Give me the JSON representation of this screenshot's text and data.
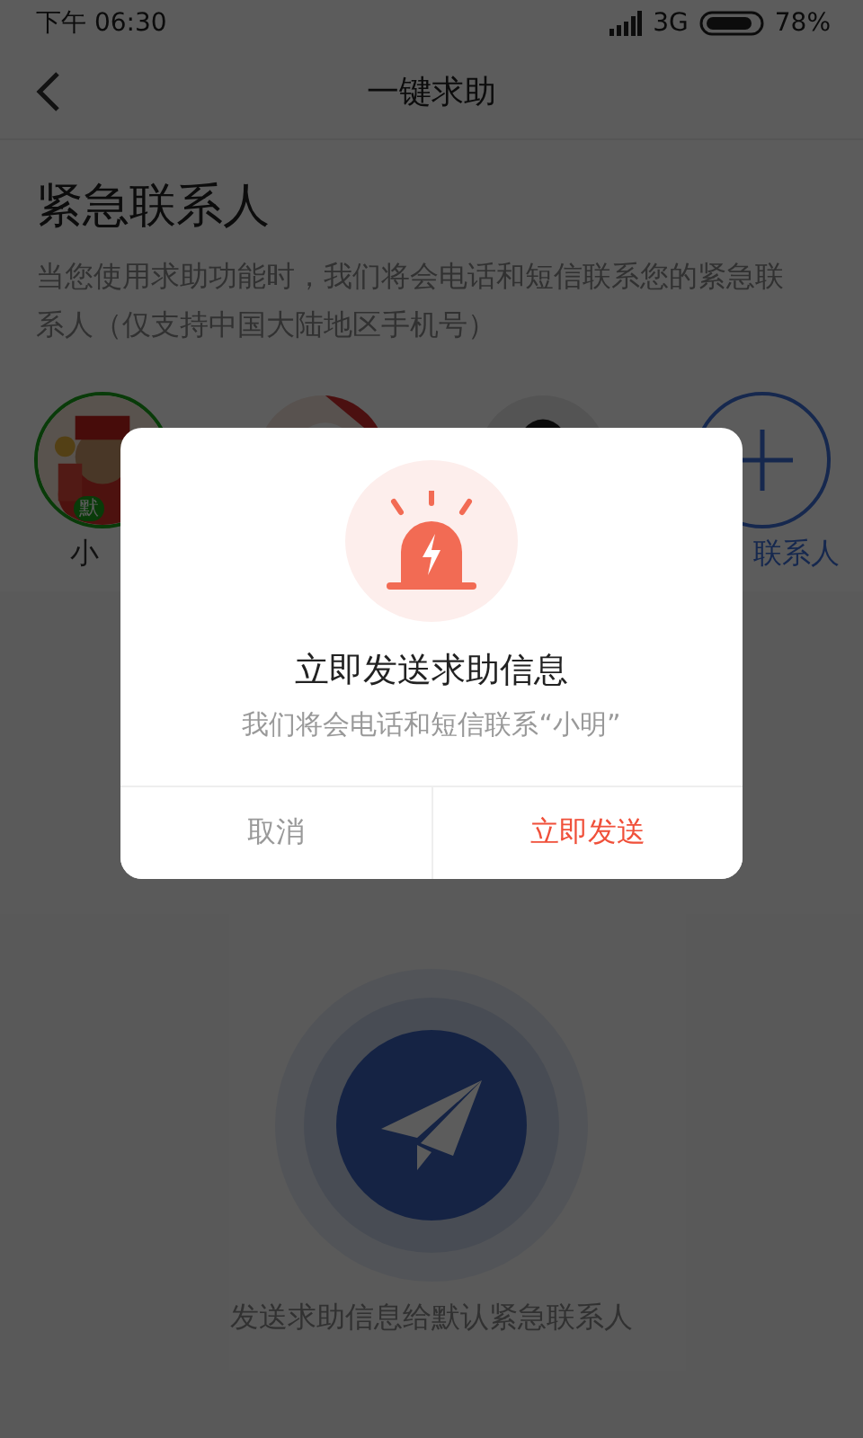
{
  "status_bar": {
    "time": "下午 06:30",
    "network": "3G",
    "battery": "78%"
  },
  "nav": {
    "title": "一键求助"
  },
  "section": {
    "title": "紧急联系人",
    "description": "当您使用求助功能时，我们将会电话和短信联系您的紧急联系人（仅支持中国大陆地区手机号）"
  },
  "contacts": [
    {
      "kind": "avatar",
      "name": "小",
      "badge": "默"
    },
    {
      "kind": "avatar"
    },
    {
      "kind": "avatar"
    },
    {
      "kind": "add",
      "name": "联系人"
    }
  ],
  "send": {
    "caption": "发送求助信息给默认紧急联系人"
  },
  "dialog": {
    "title": "立即发送求助信息",
    "message": "我们将会电话和短信联系“小明”",
    "buttons": [
      {
        "label": "取消",
        "kind": "cancel"
      },
      {
        "label": "立即发送",
        "kind": "confirm"
      }
    ]
  }
}
